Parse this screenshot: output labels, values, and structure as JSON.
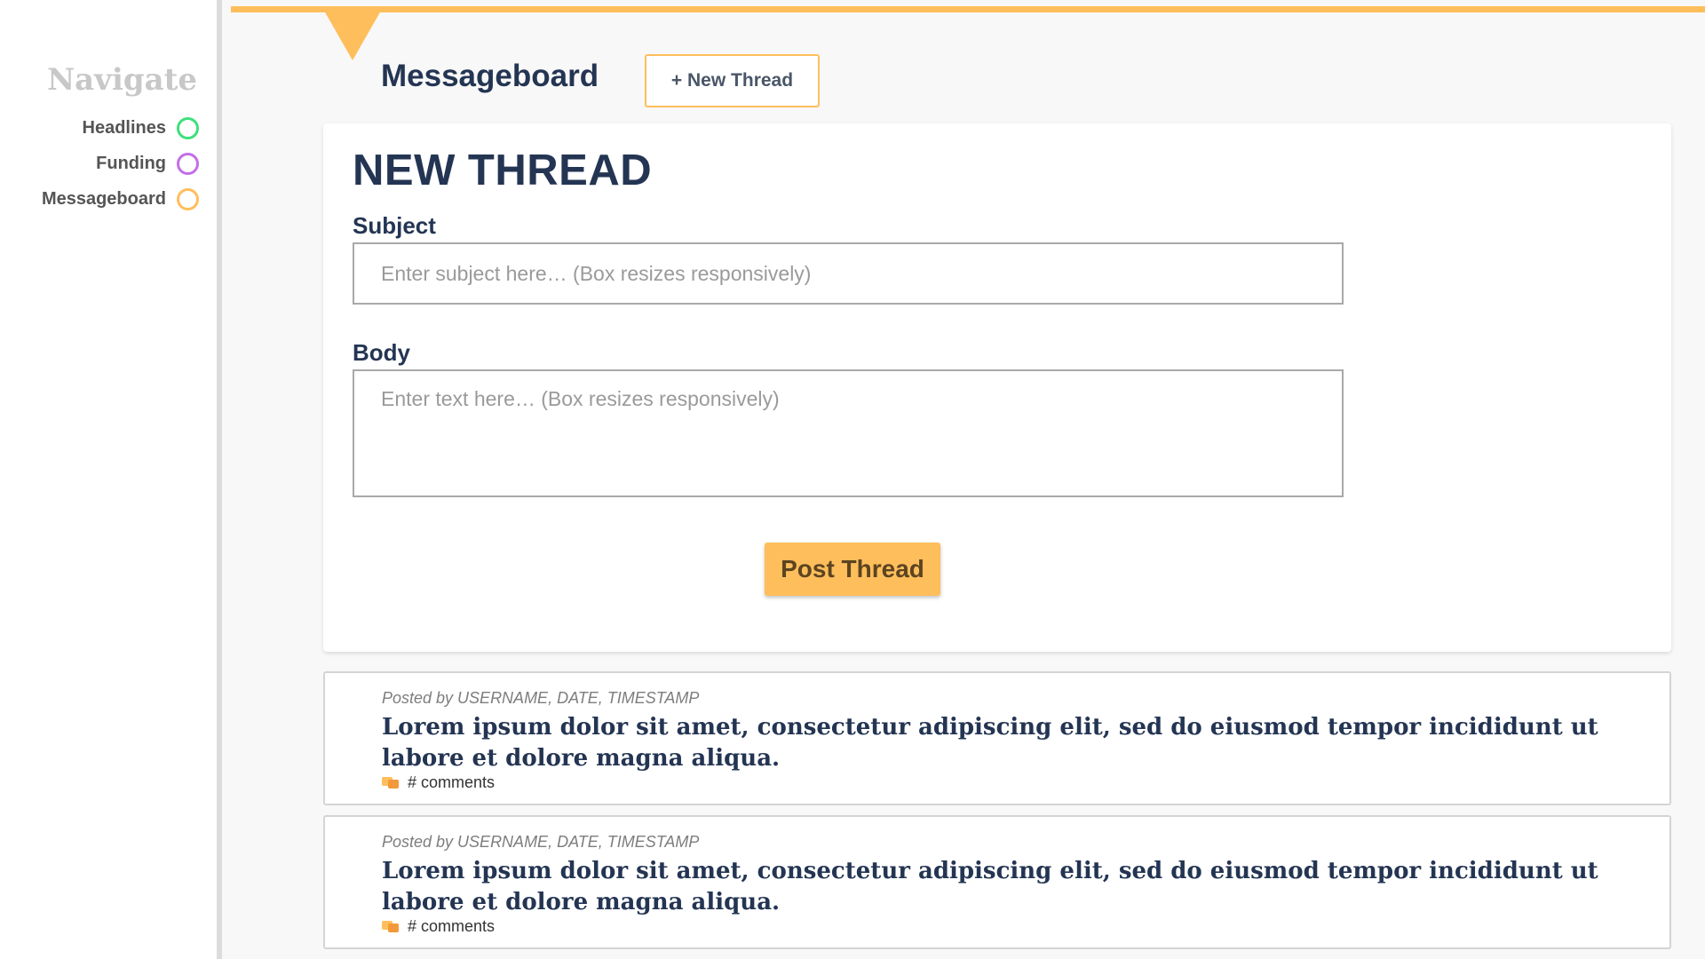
{
  "sidebar": {
    "title": "Navigate",
    "items": [
      {
        "label": "Headlines",
        "color": "#3ee07a"
      },
      {
        "label": "Funding",
        "color": "#c36ee8"
      },
      {
        "label": "Messageboard",
        "color": "#ffbe5c"
      }
    ]
  },
  "header": {
    "title": "Messageboard",
    "new_thread_label": "+ New Thread"
  },
  "form": {
    "heading": "NEW THREAD",
    "subject_label": "Subject",
    "subject_placeholder": "Enter subject here… (Box resizes responsively)",
    "subject_value": "",
    "body_label": "Body",
    "body_placeholder": "Enter text here… (Box resizes responsively)",
    "body_value": "",
    "submit_label": "Post Thread"
  },
  "threads": [
    {
      "meta": "Posted by USERNAME, DATE, TIMESTAMP",
      "title": "Lorem ipsum dolor sit amet, consectetur adipiscing elit, sed do eiusmod tempor incididunt ut labore et dolore magna aliqua.",
      "comments": "# comments",
      "icon": "comment-bubbles-icon"
    },
    {
      "meta": "Posted by USERNAME, DATE, TIMESTAMP",
      "title": "Lorem ipsum dolor sit amet, consectetur adipiscing elit, sed do eiusmod tempor incididunt ut labore et dolore magna aliqua.",
      "comments": "# comments",
      "icon": "comment-bubbles-icon"
    }
  ],
  "colors": {
    "accent": "#ffbe5c",
    "heading": "#243553"
  }
}
